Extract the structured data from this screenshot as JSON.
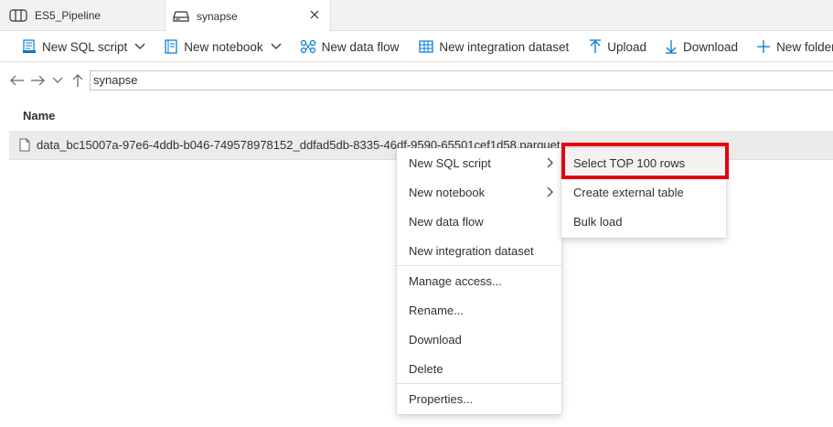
{
  "tabs": [
    {
      "label": "ES5_Pipeline",
      "icon": "pipeline-icon"
    },
    {
      "label": "synapse",
      "icon": "storage-icon",
      "active": true
    }
  ],
  "toolbar": {
    "new_sql_script": "New SQL script",
    "new_notebook": "New notebook",
    "new_data_flow": "New data flow",
    "new_integration_dataset": "New integration dataset",
    "upload": "Upload",
    "download": "Download",
    "new_folder": "New folder"
  },
  "address": {
    "path": "synapse"
  },
  "list": {
    "header_name": "Name",
    "rows": [
      {
        "name": "data_bc15007a-97e6-4ddb-b046-749578978152_ddfad5db-8335-46df-9590-65501cef1d58.parquet"
      }
    ]
  },
  "context_menu": {
    "items": [
      {
        "label": "New SQL script",
        "submenu": true
      },
      {
        "label": "New notebook",
        "submenu": true
      },
      {
        "label": "New data flow"
      },
      {
        "label": "New integration dataset"
      },
      {
        "label": "Manage access..."
      },
      {
        "label": "Rename..."
      },
      {
        "label": "Download"
      },
      {
        "label": "Delete"
      },
      {
        "label": "Properties..."
      }
    ]
  },
  "submenu": {
    "items": [
      {
        "label": "Select TOP 100 rows",
        "highlighted": true
      },
      {
        "label": "Create external table"
      },
      {
        "label": "Bulk load"
      }
    ]
  },
  "colors": {
    "accent": "#0078d4",
    "highlight_border": "#e3000f",
    "row_selected": "#edebe9"
  }
}
